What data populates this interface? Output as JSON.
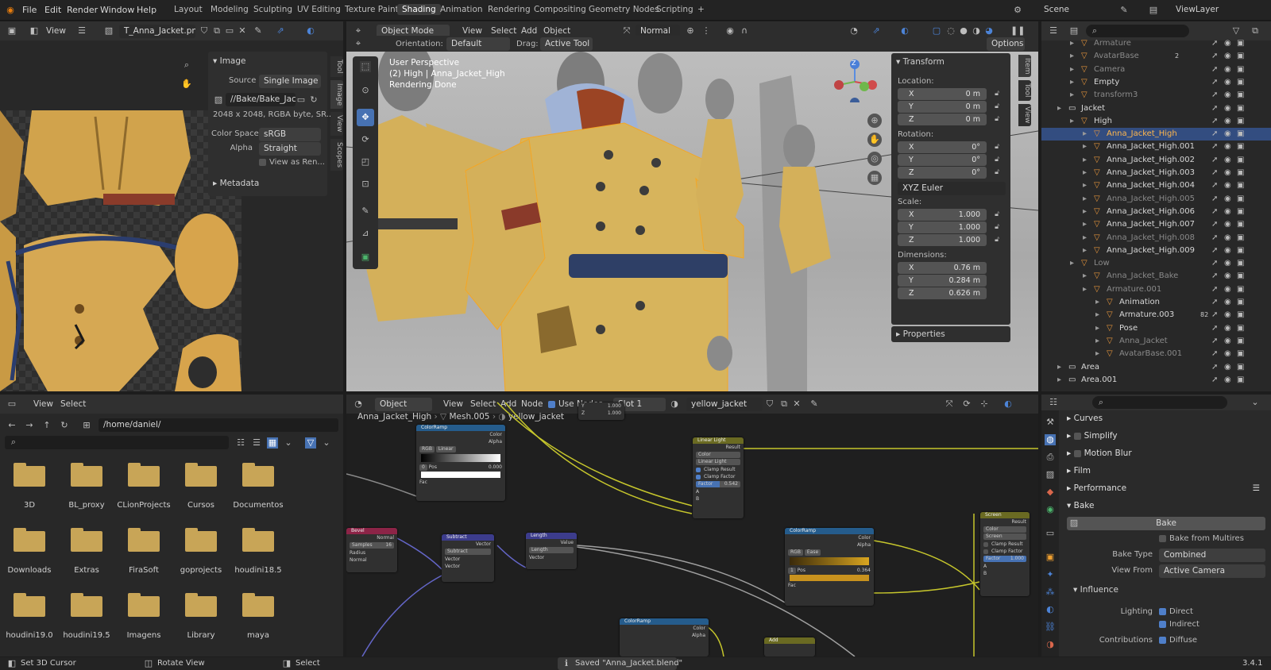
{
  "topbar": {
    "menus": [
      "File",
      "Edit",
      "Render",
      "Window",
      "Help"
    ],
    "workspaces": [
      "Layout",
      "Modeling",
      "Sculpting",
      "UV Editing",
      "Texture Paint",
      "Shading",
      "Animation",
      "Rendering",
      "Compositing",
      "Geometry Nodes",
      "Scripting"
    ],
    "active_workspace": "Shading",
    "add_tab": "+",
    "scene": "Scene",
    "view_layer": "ViewLayer"
  },
  "image_editor": {
    "view_menu": "View",
    "image_name": "T_Anna_Jacket.png",
    "panel_title": "Image",
    "source_label": "Source",
    "source_value": "Single Image",
    "filepath": "//Bake/Bake_Jac...",
    "info": "2048 x 2048,  RGBA byte,  SR...",
    "color_space_label": "Color Space",
    "color_space_value": "sRGB",
    "alpha_label": "Alpha",
    "alpha_value": "Straight",
    "view_as_render": "View as Ren...",
    "metadata": "Metadata",
    "tabs": [
      "Tool",
      "Image",
      "View",
      "Scopes"
    ]
  },
  "viewport": {
    "mode": "Object Mode",
    "menus": [
      "View",
      "Select",
      "Add",
      "Object"
    ],
    "orientation_label": "Orientation:",
    "orientation_value": "Default",
    "drag_label": "Drag:",
    "drag_value": "Active Tool",
    "options": "Options",
    "shading": "Normal",
    "info_line1": "User Perspective",
    "info_line2": "(2) High | Anna_Jacket_High",
    "info_line3": "Rendering Done",
    "tabs": [
      "Item",
      "Tool",
      "View"
    ],
    "transform": {
      "title": "Transform",
      "location_label": "Location:",
      "location": [
        {
          "axis": "X",
          "value": "0 m"
        },
        {
          "axis": "Y",
          "value": "0 m"
        },
        {
          "axis": "Z",
          "value": "0 m"
        }
      ],
      "rotation_label": "Rotation:",
      "rotation": [
        {
          "axis": "X",
          "value": "0°"
        },
        {
          "axis": "Y",
          "value": "0°"
        },
        {
          "axis": "Z",
          "value": "0°"
        }
      ],
      "rotation_mode": "XYZ Euler",
      "scale_label": "Scale:",
      "scale": [
        {
          "axis": "X",
          "value": "1.000"
        },
        {
          "axis": "Y",
          "value": "1.000"
        },
        {
          "axis": "Z",
          "value": "1.000"
        }
      ],
      "dimensions_label": "Dimensions:",
      "dimensions": [
        {
          "axis": "X",
          "value": "0.76 m"
        },
        {
          "axis": "Y",
          "value": "0.284 m"
        },
        {
          "axis": "Z",
          "value": "0.626 m"
        }
      ],
      "properties": "Properties"
    },
    "gizmo": {
      "z": "Z"
    }
  },
  "outliner": {
    "items": [
      {
        "name": "Armature",
        "indent": 2,
        "dim": true
      },
      {
        "name": "AvatarBase",
        "indent": 2,
        "dim": true,
        "badge": "2"
      },
      {
        "name": "Camera",
        "indent": 2,
        "dim": true
      },
      {
        "name": "Empty",
        "indent": 2,
        "dim": false
      },
      {
        "name": "transform3",
        "indent": 2,
        "dim": true
      },
      {
        "name": "Jacket",
        "indent": 1,
        "dim": false
      },
      {
        "name": "High",
        "indent": 2,
        "dim": false
      },
      {
        "name": "Anna_Jacket_High",
        "indent": 3,
        "dim": false,
        "selected": true
      },
      {
        "name": "Anna_Jacket_High.001",
        "indent": 3,
        "dim": false
      },
      {
        "name": "Anna_Jacket_High.002",
        "indent": 3,
        "dim": false
      },
      {
        "name": "Anna_Jacket_High.003",
        "indent": 3,
        "dim": false
      },
      {
        "name": "Anna_Jacket_High.004",
        "indent": 3,
        "dim": false
      },
      {
        "name": "Anna_Jacket_High.005",
        "indent": 3,
        "dim": true
      },
      {
        "name": "Anna_Jacket_High.006",
        "indent": 3,
        "dim": false
      },
      {
        "name": "Anna_Jacket_High.007",
        "indent": 3,
        "dim": false
      },
      {
        "name": "Anna_Jacket_High.008",
        "indent": 3,
        "dim": true
      },
      {
        "name": "Anna_Jacket_High.009",
        "indent": 3,
        "dim": false
      },
      {
        "name": "Low",
        "indent": 2,
        "dim": true
      },
      {
        "name": "Anna_Jacket_Bake",
        "indent": 3,
        "dim": true
      },
      {
        "name": "Armature.001",
        "indent": 3,
        "dim": true
      },
      {
        "name": "Animation",
        "indent": 4,
        "dim": false
      },
      {
        "name": "Armature.003",
        "indent": 4,
        "dim": false,
        "badge": "82"
      },
      {
        "name": "Pose",
        "indent": 4,
        "dim": false
      },
      {
        "name": "Anna_Jacket",
        "indent": 4,
        "dim": true
      },
      {
        "name": "AvatarBase.001",
        "indent": 4,
        "dim": true
      },
      {
        "name": "Area",
        "indent": 1,
        "dim": false
      },
      {
        "name": "Area.001",
        "indent": 1,
        "dim": false
      }
    ]
  },
  "file_browser": {
    "menus": [
      "View",
      "Select"
    ],
    "path": "/home/daniel/",
    "folders": [
      "3D",
      "BL_proxy",
      "CLionProjects",
      "Cursos",
      "Documentos",
      "Downloads",
      "Extras",
      "FiraSoft",
      "goprojects",
      "houdini18.5",
      "houdini19.0",
      "houdini19.5",
      "Imagens",
      "Library",
      "maya"
    ]
  },
  "node_editor": {
    "object_type": "Object",
    "menus": [
      "View",
      "Select",
      "Add",
      "Node"
    ],
    "use_nodes": "Use Nodes",
    "slot": "Slot 1",
    "material": "yellow_jacket",
    "breadcrumb": [
      "Anna_Jacket_High",
      "Mesh.005",
      "yellow_jacket"
    ],
    "nodes": {
      "colorramp1": {
        "title": "ColorRamp",
        "out1": "Color",
        "out2": "Alpha",
        "mode": "RGB",
        "interp": "Linear",
        "pos": "0",
        "pos_label": "Pos",
        "pos_value": "0.000",
        "fac": "Fac"
      },
      "linear_light": {
        "title": "Linear Light",
        "out": "Result",
        "f1": "Color",
        "f2": "Linear Light",
        "c1": "Clamp Result",
        "c2": "Clamp Factor",
        "fac_label": "Factor",
        "fac_value": "0.542",
        "a": "A",
        "b": "B"
      },
      "bevel": {
        "title": "Bevel",
        "out": "Normal",
        "samples_label": "Samples",
        "samples": "16",
        "r": "Radius",
        "n": "Normal"
      },
      "subtract": {
        "title": "Subtract",
        "out": "Vector",
        "op": "Subtract",
        "v1": "Vector",
        "v2": "Vector"
      },
      "length": {
        "title": "Length",
        "out": "Value",
        "op": "Length",
        "v": "Vector"
      },
      "colorramp2": {
        "title": "ColorRamp",
        "out1": "Color",
        "out2": "Alpha",
        "mode": "RGB",
        "interp": "Ease",
        "pos": "1",
        "pos_label": "Pos",
        "pos_value": "0.364",
        "fac": "Fac"
      },
      "screen": {
        "title": "Screen",
        "out": "Result",
        "f1": "Color",
        "f2": "Screen",
        "c1": "Clamp Result",
        "c2": "Clamp Factor",
        "fac_label": "Factor",
        "fac_value": "1.000",
        "a": "A",
        "b": "B"
      },
      "colorramp3": {
        "title": "ColorRamp",
        "out1": "Color",
        "out2": "Alpha"
      },
      "add": {
        "title": "Add"
      },
      "top_partial": {
        "y": "Y",
        "y_val": "1.000",
        "z": "Z",
        "z_val": "1.000"
      }
    }
  },
  "properties": {
    "sections": [
      "Curves",
      "Simplify",
      "Motion Blur",
      "Film",
      "Performance",
      "Bake"
    ],
    "bake_button": "Bake",
    "bake_from_multires": "Bake from Multires",
    "bake_type_label": "Bake Type",
    "bake_type_value": "Combined",
    "view_from_label": "View From",
    "view_from_value": "Active Camera",
    "influence": "Influence",
    "lighting_label": "Lighting",
    "direct": "Direct",
    "indirect": "Indirect",
    "contributions_label": "Contributions",
    "diffuse": "Diffuse"
  },
  "statusbar": {
    "hint1": "Set 3D Cursor",
    "hint2": "Rotate View",
    "hint3": "Select",
    "message": "Saved \"Anna_Jacket.blend\"",
    "version": "3.4.1"
  },
  "colors": {
    "accent": "#4772b3",
    "selection": "#f5a623",
    "folder": "#c8a557",
    "bg": "#1d1d1d"
  }
}
